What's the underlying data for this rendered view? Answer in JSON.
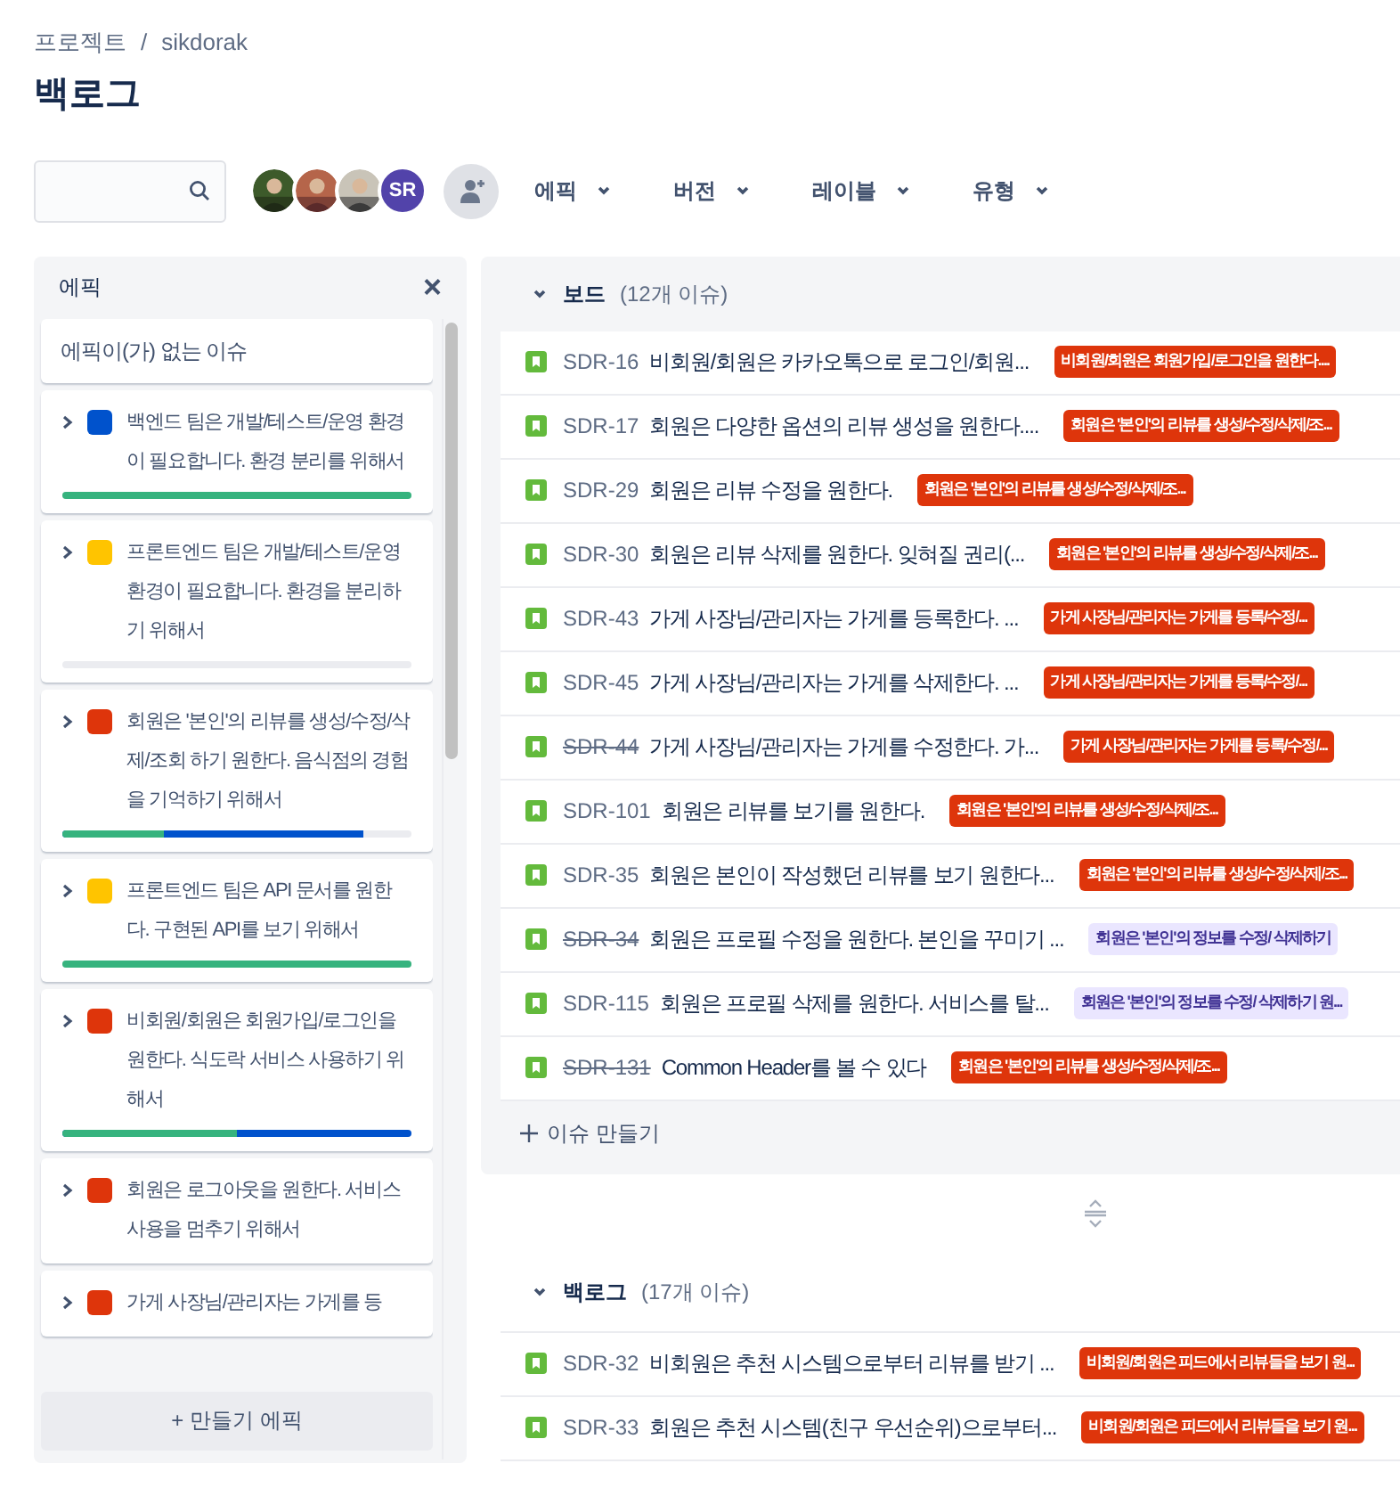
{
  "breadcrumb": [
    "프로젝트",
    "/",
    "sikdorak"
  ],
  "title": "백로그",
  "toolbar": {
    "avatars": [
      {
        "kind": "picture"
      },
      {
        "kind": "picture"
      },
      {
        "kind": "picture"
      },
      {
        "kind": "initials",
        "initials": "SR"
      }
    ],
    "filters": [
      {
        "label": "에픽"
      },
      {
        "label": "버전"
      },
      {
        "label": "레이블"
      },
      {
        "label": "유형"
      }
    ]
  },
  "epic_panel": {
    "title": "에픽",
    "close": "×",
    "no_epic": "에픽이(가) 없는 이슈",
    "epics": [
      {
        "title": "백엔드 팀은 개발/테스트/운영 환경이 필요합니다. 환경 분리를 위해서",
        "color": "#0052cc",
        "progress": [
          {
            "kind": "done",
            "level": 1
          }
        ]
      },
      {
        "title": "프론트엔드 팀은 개발/테스트/운영 환경이 필요합니다. 환경을 분리하기 위해서",
        "color": "#ffc400",
        "progress": [
          {
            "kind": "done",
            "level": 0
          }
        ]
      },
      {
        "title": "회원은 '본인'의 리뷰를 생성/수정/삭제/조회 하기 원한다. 음식점의 경험을 기억하기 위해서",
        "color": "#de350b",
        "progress": [
          {
            "kind": "done",
            "level": 0.29
          },
          {
            "kind": "started",
            "level": 0.86
          }
        ]
      },
      {
        "title": "프론트엔드 팀은 API 문서를 원한다. 구현된 API를 보기 위해서",
        "color": "#ffc400",
        "progress": [
          {
            "kind": "done",
            "level": 1
          }
        ]
      },
      {
        "title": "비회원/회원은 회원가입/로그인을 원한다. 식도락 서비스 사용하기 위해서",
        "color": "#de350b",
        "progress": [
          {
            "kind": "done",
            "level": 0.5
          },
          {
            "kind": "started",
            "level": 1
          }
        ]
      },
      {
        "title": "회원은 로그아웃을 원한다. 서비스 사용을 멈추기 위해서",
        "color": "#de350b"
      },
      {
        "title": "가게 사장님/관리자는 가게를 등",
        "color": "#de350b"
      }
    ],
    "create": "+ 만들기 에픽"
  },
  "sprint": {
    "name": "보드",
    "count": "(12개 이슈)",
    "expanded": true,
    "issues": [
      {
        "key": "SDR-16",
        "done": false,
        "summary": "비회원/회원은 카카오톡으로 로그인/회원...",
        "epic": {
          "text": "비회원/회원은 회원가입/로그인을 원한다....",
          "color": "#de350b"
        }
      },
      {
        "key": "SDR-17",
        "done": false,
        "summary": "회원은 다양한 옵션의 리뷰 생성을 원한다....",
        "epic": {
          "text": "회원은 '본인'의 리뷰를 생성/수정/삭제/조...",
          "color": "#de350b"
        }
      },
      {
        "key": "SDR-29",
        "done": false,
        "summary": "회원은 리뷰 수정을 원한다.",
        "epic": {
          "text": "회원은 '본인'의 리뷰를 생성/수정/삭제/조...",
          "color": "#de350b"
        }
      },
      {
        "key": "SDR-30",
        "done": false,
        "summary": "회원은 리뷰 삭제를 원한다. 잊혀질 권리(...",
        "epic": {
          "text": "회원은 '본인'의 리뷰를 생성/수정/삭제/조...",
          "color": "#de350b"
        }
      },
      {
        "key": "SDR-43",
        "done": false,
        "summary": "가게 사장님/관리자는 가게를 등록한다. ...",
        "epic": {
          "text": "가게 사장님/관리자는 가게를 등록/수정/...",
          "color": "#de350b"
        }
      },
      {
        "key": "SDR-45",
        "done": false,
        "summary": "가게 사장님/관리자는 가게를 삭제한다. ...",
        "epic": {
          "text": "가게 사장님/관리자는 가게를 등록/수정/...",
          "color": "#de350b"
        }
      },
      {
        "key": "SDR-44",
        "done": true,
        "summary": "가게 사장님/관리자는 가게를 수정한다. 가...",
        "epic": {
          "text": "가게 사장님/관리자는 가게를 등록/수정/...",
          "color": "#de350b"
        }
      },
      {
        "key": "SDR-101",
        "done": false,
        "summary": "회원은 리뷰를 보기를 원한다.",
        "epic": {
          "text": "회원은 '본인'의 리뷰를 생성/수정/삭제/조...",
          "color": "#de350b"
        }
      },
      {
        "key": "SDR-35",
        "done": false,
        "summary": "회원은 본인이 작성했던 리뷰를 보기 원한다...",
        "epic": {
          "text": "회원은 '본인'의 리뷰를 생성/수정/삭제/조...",
          "color": "#de350b"
        }
      },
      {
        "key": "SDR-34",
        "done": true,
        "summary": "회원은 프로필 수정을 원한다. 본인을 꾸미기 ...",
        "epic": {
          "text": "회원은 '본인'의 정보를 수정/ 삭제하기",
          "color": "#eae6ff"
        }
      },
      {
        "key": "SDR-115",
        "done": false,
        "summary": "회원은 프로필 삭제를 원한다. 서비스를 탈...",
        "epic": {
          "text": "회원은 '본인'의 정보를 수정/ 삭제하기 원...",
          "color": "#eae6ff"
        }
      },
      {
        "key": "SDR-131",
        "done": true,
        "summary": "Common Header를 볼 수 있다",
        "epic": {
          "text": "회원은 '본인'의 리뷰를 생성/수정/삭제/조...",
          "color": "#de350b"
        }
      }
    ],
    "create": "이슈 만들기"
  },
  "backlog": {
    "name": "백로그",
    "count": "(17개 이슈)",
    "expanded": true,
    "issues": [
      {
        "key": "SDR-32",
        "done": false,
        "summary": "비회원은 추천 시스템으로부터 리뷰를 받기 ...",
        "epic": {
          "text": "비회원/회원은 피드에서 리뷰들을 보기 원...",
          "color": "#de350b"
        }
      },
      {
        "key": "SDR-33",
        "done": false,
        "summary": "회원은 추천 시스템(친구 우선순위)으로부터...",
        "epic": {
          "text": "비회원/회원은 피드에서 리뷰들을 보기 원...",
          "color": "#de350b"
        }
      }
    ]
  }
}
